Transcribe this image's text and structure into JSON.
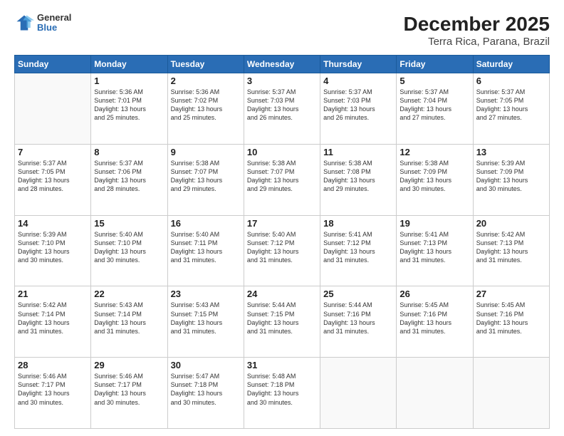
{
  "header": {
    "logo": {
      "general": "General",
      "blue": "Blue"
    },
    "title": "December 2025",
    "subtitle": "Terra Rica, Parana, Brazil"
  },
  "weekdays": [
    "Sunday",
    "Monday",
    "Tuesday",
    "Wednesday",
    "Thursday",
    "Friday",
    "Saturday"
  ],
  "weeks": [
    [
      {
        "day": "",
        "sunrise": "",
        "sunset": "",
        "daylight": ""
      },
      {
        "day": "1",
        "sunrise": "Sunrise: 5:36 AM",
        "sunset": "Sunset: 7:01 PM",
        "daylight": "Daylight: 13 hours and 25 minutes."
      },
      {
        "day": "2",
        "sunrise": "Sunrise: 5:36 AM",
        "sunset": "Sunset: 7:02 PM",
        "daylight": "Daylight: 13 hours and 25 minutes."
      },
      {
        "day": "3",
        "sunrise": "Sunrise: 5:37 AM",
        "sunset": "Sunset: 7:03 PM",
        "daylight": "Daylight: 13 hours and 26 minutes."
      },
      {
        "day": "4",
        "sunrise": "Sunrise: 5:37 AM",
        "sunset": "Sunset: 7:03 PM",
        "daylight": "Daylight: 13 hours and 26 minutes."
      },
      {
        "day": "5",
        "sunrise": "Sunrise: 5:37 AM",
        "sunset": "Sunset: 7:04 PM",
        "daylight": "Daylight: 13 hours and 27 minutes."
      },
      {
        "day": "6",
        "sunrise": "Sunrise: 5:37 AM",
        "sunset": "Sunset: 7:05 PM",
        "daylight": "Daylight: 13 hours and 27 minutes."
      }
    ],
    [
      {
        "day": "7",
        "sunrise": "Sunrise: 5:37 AM",
        "sunset": "Sunset: 7:05 PM",
        "daylight": "Daylight: 13 hours and 28 minutes."
      },
      {
        "day": "8",
        "sunrise": "Sunrise: 5:37 AM",
        "sunset": "Sunset: 7:06 PM",
        "daylight": "Daylight: 13 hours and 28 minutes."
      },
      {
        "day": "9",
        "sunrise": "Sunrise: 5:38 AM",
        "sunset": "Sunset: 7:07 PM",
        "daylight": "Daylight: 13 hours and 29 minutes."
      },
      {
        "day": "10",
        "sunrise": "Sunrise: 5:38 AM",
        "sunset": "Sunset: 7:07 PM",
        "daylight": "Daylight: 13 hours and 29 minutes."
      },
      {
        "day": "11",
        "sunrise": "Sunrise: 5:38 AM",
        "sunset": "Sunset: 7:08 PM",
        "daylight": "Daylight: 13 hours and 29 minutes."
      },
      {
        "day": "12",
        "sunrise": "Sunrise: 5:38 AM",
        "sunset": "Sunset: 7:09 PM",
        "daylight": "Daylight: 13 hours and 30 minutes."
      },
      {
        "day": "13",
        "sunrise": "Sunrise: 5:39 AM",
        "sunset": "Sunset: 7:09 PM",
        "daylight": "Daylight: 13 hours and 30 minutes."
      }
    ],
    [
      {
        "day": "14",
        "sunrise": "Sunrise: 5:39 AM",
        "sunset": "Sunset: 7:10 PM",
        "daylight": "Daylight: 13 hours and 30 minutes."
      },
      {
        "day": "15",
        "sunrise": "Sunrise: 5:40 AM",
        "sunset": "Sunset: 7:10 PM",
        "daylight": "Daylight: 13 hours and 30 minutes."
      },
      {
        "day": "16",
        "sunrise": "Sunrise: 5:40 AM",
        "sunset": "Sunset: 7:11 PM",
        "daylight": "Daylight: 13 hours and 31 minutes."
      },
      {
        "day": "17",
        "sunrise": "Sunrise: 5:40 AM",
        "sunset": "Sunset: 7:12 PM",
        "daylight": "Daylight: 13 hours and 31 minutes."
      },
      {
        "day": "18",
        "sunrise": "Sunrise: 5:41 AM",
        "sunset": "Sunset: 7:12 PM",
        "daylight": "Daylight: 13 hours and 31 minutes."
      },
      {
        "day": "19",
        "sunrise": "Sunrise: 5:41 AM",
        "sunset": "Sunset: 7:13 PM",
        "daylight": "Daylight: 13 hours and 31 minutes."
      },
      {
        "day": "20",
        "sunrise": "Sunrise: 5:42 AM",
        "sunset": "Sunset: 7:13 PM",
        "daylight": "Daylight: 13 hours and 31 minutes."
      }
    ],
    [
      {
        "day": "21",
        "sunrise": "Sunrise: 5:42 AM",
        "sunset": "Sunset: 7:14 PM",
        "daylight": "Daylight: 13 hours and 31 minutes."
      },
      {
        "day": "22",
        "sunrise": "Sunrise: 5:43 AM",
        "sunset": "Sunset: 7:14 PM",
        "daylight": "Daylight: 13 hours and 31 minutes."
      },
      {
        "day": "23",
        "sunrise": "Sunrise: 5:43 AM",
        "sunset": "Sunset: 7:15 PM",
        "daylight": "Daylight: 13 hours and 31 minutes."
      },
      {
        "day": "24",
        "sunrise": "Sunrise: 5:44 AM",
        "sunset": "Sunset: 7:15 PM",
        "daylight": "Daylight: 13 hours and 31 minutes."
      },
      {
        "day": "25",
        "sunrise": "Sunrise: 5:44 AM",
        "sunset": "Sunset: 7:16 PM",
        "daylight": "Daylight: 13 hours and 31 minutes."
      },
      {
        "day": "26",
        "sunrise": "Sunrise: 5:45 AM",
        "sunset": "Sunset: 7:16 PM",
        "daylight": "Daylight: 13 hours and 31 minutes."
      },
      {
        "day": "27",
        "sunrise": "Sunrise: 5:45 AM",
        "sunset": "Sunset: 7:16 PM",
        "daylight": "Daylight: 13 hours and 31 minutes."
      }
    ],
    [
      {
        "day": "28",
        "sunrise": "Sunrise: 5:46 AM",
        "sunset": "Sunset: 7:17 PM",
        "daylight": "Daylight: 13 hours and 30 minutes."
      },
      {
        "day": "29",
        "sunrise": "Sunrise: 5:46 AM",
        "sunset": "Sunset: 7:17 PM",
        "daylight": "Daylight: 13 hours and 30 minutes."
      },
      {
        "day": "30",
        "sunrise": "Sunrise: 5:47 AM",
        "sunset": "Sunset: 7:18 PM",
        "daylight": "Daylight: 13 hours and 30 minutes."
      },
      {
        "day": "31",
        "sunrise": "Sunrise: 5:48 AM",
        "sunset": "Sunset: 7:18 PM",
        "daylight": "Daylight: 13 hours and 30 minutes."
      },
      {
        "day": "",
        "sunrise": "",
        "sunset": "",
        "daylight": ""
      },
      {
        "day": "",
        "sunrise": "",
        "sunset": "",
        "daylight": ""
      },
      {
        "day": "",
        "sunrise": "",
        "sunset": "",
        "daylight": ""
      }
    ]
  ]
}
